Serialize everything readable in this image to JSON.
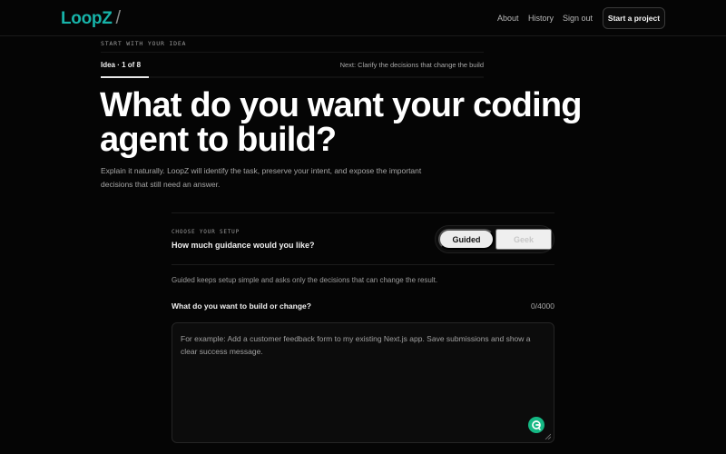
{
  "nav": {
    "logo": "LoopZ",
    "logo_slash": "/",
    "about": "About",
    "history": "History",
    "sign_out": "Sign out",
    "start_project": "Start a project"
  },
  "eyebrow": "START WITH YOUR IDEA",
  "progress": {
    "label": "Idea · 1 of 8",
    "next": "Next: Clarify the decisions that change the build",
    "current_step": 1,
    "total_steps": 8
  },
  "headline": "What do you want your coding agent to build?",
  "intro": "Explain it naturally. LoopZ will identify the task, preserve your intent, and expose the important decisions that still need an answer.",
  "setup": {
    "eyebrow": "CHOOSE YOUR SETUP",
    "question": "How much guidance would you like?",
    "options": [
      "Guided",
      "Geek"
    ],
    "selected": "Guided",
    "note": "Guided keeps setup simple and asks only the decisions that can change the result."
  },
  "build_field": {
    "label": "What do you want to build or change?",
    "count": "0/4000",
    "value": "",
    "placeholder": "For example: Add a customer feedback form to my existing Next.js app. Save submissions and show a clear success message."
  },
  "icons": {
    "assistant": "grammar-assistant-icon",
    "resize": "resize-handle-icon"
  },
  "colors": {
    "background": "#050505",
    "brand": "#17b3a9",
    "selected_toggle": "#ececec",
    "assistant_icon": "#15b884"
  }
}
